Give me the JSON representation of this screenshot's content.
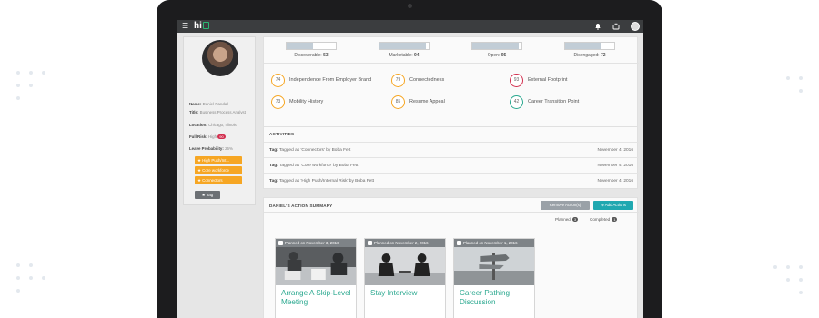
{
  "app": {
    "logo_text": "hi",
    "logo_color": "#2bb673"
  },
  "topbar": {
    "icons": [
      "menu-icon",
      "bell-icon",
      "briefcase-icon",
      "user-avatar"
    ]
  },
  "profile": {
    "name_label": "Name:",
    "name": "Daniel Randall",
    "title_label": "Title:",
    "title": "Business Process Analyst",
    "location_label": "Location:",
    "location": "Chicago, Illinois",
    "risk_label": "Full Risk:",
    "risk_level": "High",
    "risk_score": "90",
    "leave_label": "Leave Probability:",
    "leave_value": "26%",
    "tags": [
      "High Push/Int...",
      "Core workforce",
      "Connectors"
    ],
    "tag_button": "Tag"
  },
  "metrics": [
    {
      "label": "Discoverable",
      "value": "53",
      "fraction": 0.53
    },
    {
      "label": "Marketable",
      "value": "94",
      "fraction": 0.94
    },
    {
      "label": "Open",
      "value": "95",
      "fraction": 0.95
    },
    {
      "label": "Disengaged",
      "value": "72",
      "fraction": 0.72
    }
  ],
  "scores": [
    {
      "value": "74",
      "label": "Independence From Employer Brand",
      "color": "#f6a623"
    },
    {
      "value": "79",
      "label": "Connectedness",
      "color": "#f6a623"
    },
    {
      "value": "93",
      "label": "External Footprint",
      "color": "#d22e4e"
    },
    {
      "value": "73",
      "label": "Mobility History",
      "color": "#f6a623"
    },
    {
      "value": "85",
      "label": "Resume Appeal",
      "color": "#f6a623"
    },
    {
      "value": "42",
      "label": "Career Transition Point",
      "color": "#2aa88f"
    }
  ],
  "activities": {
    "header": "ACTIVITIES",
    "rows": [
      {
        "prefix": "Tag:",
        "text": "Tagged as 'Connectors' by Boba Fett",
        "date": "November 4, 2016"
      },
      {
        "prefix": "Tag:",
        "text": "Tagged as 'Core workforce' by Boba Fett",
        "date": "November 4, 2016"
      },
      {
        "prefix": "Tag:",
        "text": "Tagged as 'High Push/Internal Risk' by Boba Fett",
        "date": "November 4, 2016"
      }
    ]
  },
  "actions": {
    "header": "DANIEL'S ACTION SUMMARY",
    "remove_label": "Remove Action(s)",
    "add_label": "Add Actions",
    "planned_label": "Planned",
    "planned_count": "3",
    "completed_label": "Completed",
    "completed_count": "1",
    "cards": [
      {
        "planned": "Planned on November 3, 2016",
        "title": "Arrange A Skip-Level Meeting"
      },
      {
        "planned": "Planned on November 2, 2016",
        "title": "Stay Interview"
      },
      {
        "planned": "Planned on November 1, 2016",
        "title": "Career Pathing Discussion"
      }
    ]
  }
}
